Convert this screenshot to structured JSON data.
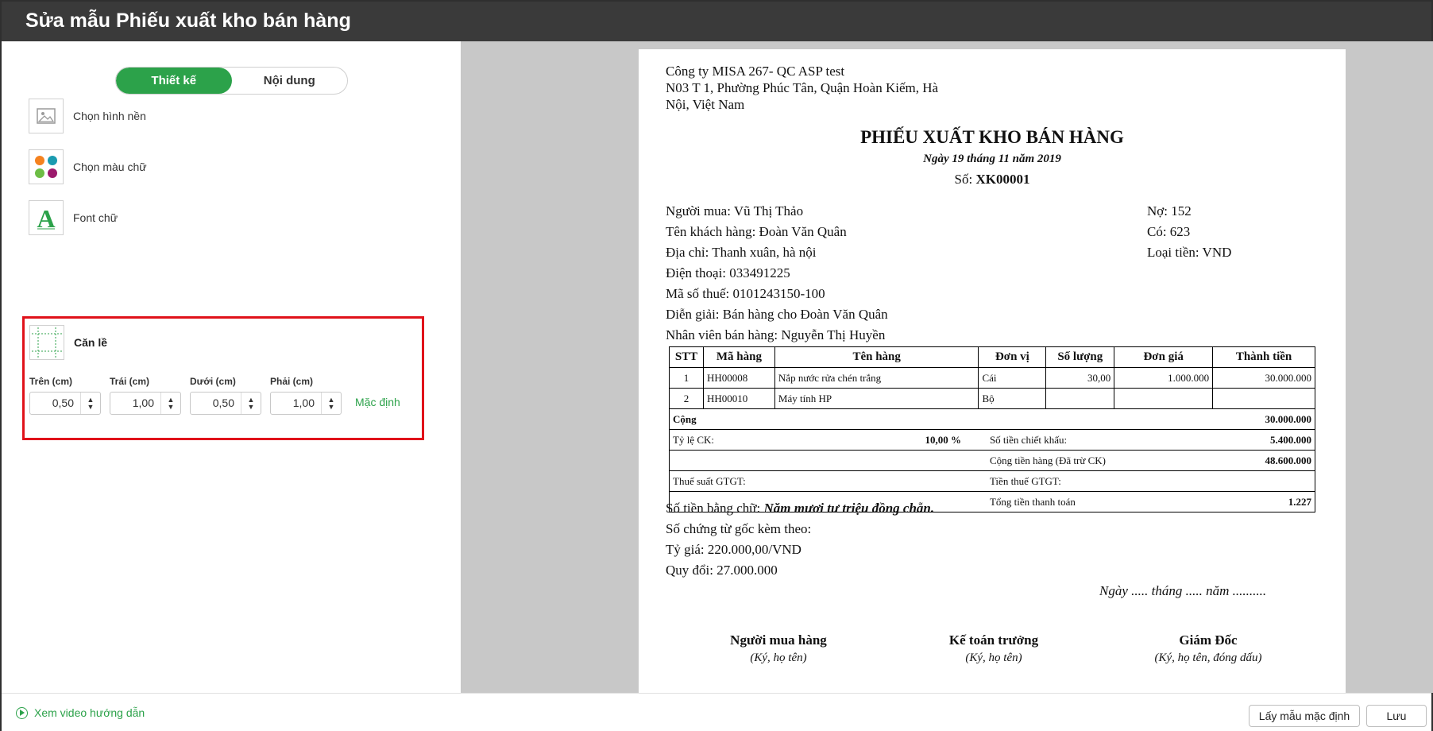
{
  "window": {
    "title": "Sửa mẫu Phiếu xuất kho bán hàng"
  },
  "tabs": {
    "design": "Thiết kế",
    "content": "Nội dung"
  },
  "options": [
    {
      "label": "Chọn hình nền",
      "icon": "image-icon"
    },
    {
      "label": "Chọn màu chữ",
      "icon": "color-palette-icon"
    },
    {
      "label": "Font chữ",
      "icon": "font-icon"
    }
  ],
  "margins": {
    "title": "Căn lề",
    "fields": [
      {
        "caption": "Trên (cm)",
        "value": "0,50"
      },
      {
        "caption": "Trái (cm)",
        "value": "1,00"
      },
      {
        "caption": "Dưới (cm)",
        "value": "0,50"
      },
      {
        "caption": "Phải (cm)",
        "value": "1,00"
      }
    ],
    "default_label": "Mặc định"
  },
  "doc": {
    "company_line1": "Công ty MISA 267- QC ASP test",
    "company_line2": "N03 T 1, Phường Phúc Tân, Quận Hoàn Kiếm, Hà",
    "company_line3": "Nội, Việt Nam",
    "title": "PHIẾU XUẤT KHO BÁN HÀNG",
    "date": "Ngày 19 tháng 11 năm 2019",
    "number_label": "Số:",
    "number_value": "XK00001",
    "buyer": "Người mua: Vũ Thị Thảo",
    "customer": "Tên khách hàng: Đoàn Văn Quân",
    "address": "Địa chỉ: Thanh xuân, hà nội",
    "phone": "Điện thoại: 033491225",
    "tax_code": "Mã số thuế: 0101243150-100",
    "description": "Diễn giải: Bán hàng cho Đoàn Văn Quân",
    "seller": "Nhân viên bán hàng: Nguyễn Thị Huyền",
    "debit": "Nợ: 152",
    "credit": "Có: 623",
    "currency": "Loại tiền: VND",
    "table": {
      "headers": [
        "STT",
        "Mã hàng",
        "Tên hàng",
        "Đơn vị",
        "Số lượng",
        "Đơn giá",
        "Thành tiền"
      ],
      "rows": [
        [
          "1",
          "HH00008",
          "Nắp nước rửa chén trắng",
          "Cái",
          "30,00",
          "1.000.000",
          "30.000.000"
        ],
        [
          "2",
          "HH00010",
          "Máy tính HP",
          "Bộ",
          "",
          "",
          ""
        ]
      ],
      "total_label": "Cộng",
      "total_value": "30.000.000",
      "discount_rate_label": "Tỷ lệ CK:",
      "discount_rate_value": "10,00 %",
      "discount_amount_label": "Số tiền chiết khấu:",
      "discount_amount_value": "5.400.000",
      "goods_total_label": "Cộng tiền hàng (Đã trừ CK)",
      "goods_total_value": "48.600.000",
      "vat_rate_label": "Thuế suất GTGT:",
      "vat_amount_label": "Tiền thuế GTGT:",
      "grand_total_label": "Tổng tiền thanh toán",
      "grand_total_value": "1.227"
    },
    "amount_words_label": "Số tiền bằng chữ:",
    "amount_words_value": "Năm mươi tư triệu đồng chẵn.",
    "attached": "Số chứng từ gốc kèm theo:",
    "rate": "Tỷ giá: 220.000,00/VND",
    "converted": "Quy đổi: 27.000.000",
    "date_placeholder": "Ngày ..... tháng ..... năm ..........",
    "signatures": [
      {
        "title": "Người mua hàng",
        "sub": "(Ký, họ tên)"
      },
      {
        "title": "Kế toán trưởng",
        "sub": "(Ký, họ tên)"
      },
      {
        "title": "Giám Đốc",
        "sub": "(Ký, họ tên, đóng dấu)"
      }
    ]
  },
  "footer": {
    "video_link": "Xem video hướng dẫn",
    "default_template_button": "Lấy mẫu mặc định",
    "save_button": "Lưu"
  },
  "colors": {
    "accent": "#2ca24a",
    "titlebar": "#3a3a3a",
    "highlight": "#e0121a",
    "preview_bg": "#c8c8c8"
  }
}
